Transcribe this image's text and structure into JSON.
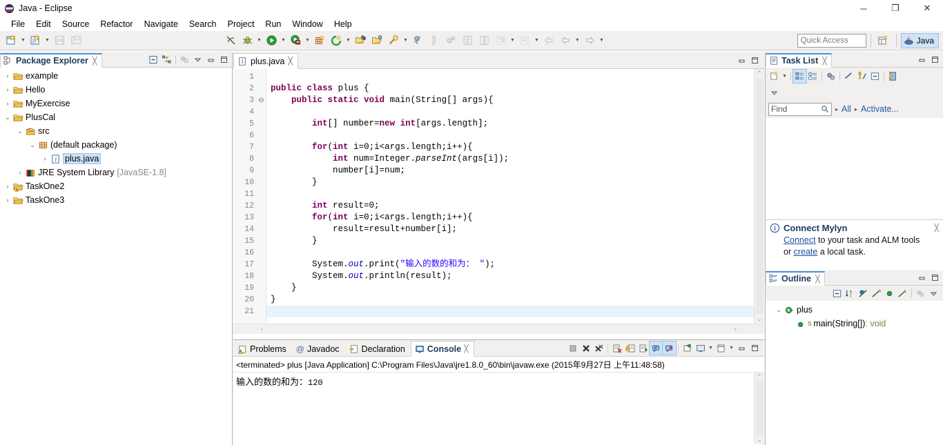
{
  "window": {
    "title": "Java - Eclipse",
    "app_icon": "eclipse-icon",
    "minimize": "─",
    "maximize": "❐",
    "close": "✕"
  },
  "menu": {
    "items": [
      {
        "label": "File"
      },
      {
        "label": "Edit"
      },
      {
        "label": "Source"
      },
      {
        "label": "Refactor"
      },
      {
        "label": "Navigate"
      },
      {
        "label": "Search"
      },
      {
        "label": "Project"
      },
      {
        "label": "Run"
      },
      {
        "label": "Window"
      },
      {
        "label": "Help"
      }
    ]
  },
  "toolbar": {
    "icons": [
      {
        "name": "new-wizard-icon"
      },
      {
        "name": "new-java-class-icon"
      },
      {
        "name": "save-icon"
      },
      {
        "name": "save-all-icon"
      },
      {
        "name": "toggle-mark-occurrences-icon"
      },
      {
        "name": "debug-icon"
      },
      {
        "name": "run-icon"
      },
      {
        "name": "run-external-tools-icon"
      },
      {
        "name": "new-java-package-icon"
      },
      {
        "name": "coverage-icon"
      },
      {
        "name": "open-type-icon"
      },
      {
        "name": "open-task-icon"
      },
      {
        "name": "search-icon"
      },
      {
        "name": "skip-all-breakpoints-icon"
      },
      {
        "name": "next-annotation-icon"
      },
      {
        "name": "previous-annotation-icon"
      },
      {
        "name": "last-edit-location-icon"
      },
      {
        "name": "back-icon"
      },
      {
        "name": "forward-icon"
      }
    ],
    "quick_access_placeholder": "Quick Access",
    "open-perspective-icon": "open-perspective-icon",
    "perspective_label": "Java",
    "perspective_icon": "java-perspective-icon"
  },
  "package_explorer": {
    "title": "Package Explorer",
    "tab_close": "╳",
    "tools": [
      {
        "name": "collapse-all-icon"
      },
      {
        "name": "link-with-editor-icon"
      },
      {
        "name": "focus-on-active-task-icon"
      },
      {
        "name": "view-menu-icon"
      },
      {
        "name": "minimize-icon"
      },
      {
        "name": "maximize-icon"
      }
    ],
    "tree": [
      {
        "label": "example",
        "icon": "project-folder-icon",
        "indent": 0,
        "twisty": "›",
        "selected": false
      },
      {
        "label": "Hello",
        "icon": "project-folder-icon",
        "indent": 0,
        "twisty": "›",
        "selected": false
      },
      {
        "label": "MyExercise",
        "icon": "project-folder-icon",
        "indent": 0,
        "twisty": "›",
        "selected": false
      },
      {
        "label": "PlusCal",
        "icon": "project-folder-icon",
        "indent": 0,
        "twisty": "⌄",
        "selected": false
      },
      {
        "label": "src",
        "icon": "source-folder-icon",
        "indent": 1,
        "twisty": "⌄",
        "selected": false
      },
      {
        "label": "(default package)",
        "icon": "package-icon",
        "indent": 2,
        "twisty": "⌄",
        "selected": false
      },
      {
        "label": "plus.java",
        "icon": "java-file-icon",
        "indent": 3,
        "twisty": "›",
        "selected": true
      },
      {
        "label": "JRE System Library",
        "sublabel": "[JavaSE-1.8]",
        "icon": "jre-library-icon",
        "indent": 1,
        "twisty": "›",
        "selected": false
      },
      {
        "label": "TaskOne2",
        "icon": "project-folder-warning-icon",
        "indent": 0,
        "twisty": "›",
        "selected": false
      },
      {
        "label": "TaskOne3",
        "icon": "project-folder-icon",
        "indent": 0,
        "twisty": "›",
        "selected": false
      }
    ]
  },
  "editor": {
    "tab_label": "plus.java",
    "tab_icon": "java-file-icon",
    "tab_close": "╳",
    "tools": [
      {
        "name": "minimize-icon"
      },
      {
        "name": "maximize-icon"
      }
    ],
    "current_line": 21,
    "lines": [
      {
        "n": 1,
        "fold": "",
        "tokens": []
      },
      {
        "n": 2,
        "fold": "",
        "tokens": [
          {
            "t": "public ",
            "c": "kw"
          },
          {
            "t": "class ",
            "c": "kw"
          },
          {
            "t": "plus {",
            "c": "pl"
          }
        ]
      },
      {
        "n": 3,
        "fold": "⊖",
        "tokens": [
          {
            "t": "    ",
            "c": "pl"
          },
          {
            "t": "public ",
            "c": "kw"
          },
          {
            "t": "static ",
            "c": "kw"
          },
          {
            "t": "void ",
            "c": "kw"
          },
          {
            "t": "main(String[] args){",
            "c": "pl"
          }
        ]
      },
      {
        "n": 4,
        "fold": "",
        "tokens": []
      },
      {
        "n": 5,
        "fold": "",
        "tokens": [
          {
            "t": "        ",
            "c": "pl"
          },
          {
            "t": "int",
            "c": "kw"
          },
          {
            "t": "[] number=",
            "c": "pl"
          },
          {
            "t": "new ",
            "c": "kw"
          },
          {
            "t": "int",
            "c": "kw"
          },
          {
            "t": "[args.length];",
            "c": "pl"
          }
        ]
      },
      {
        "n": 6,
        "fold": "",
        "tokens": []
      },
      {
        "n": 7,
        "fold": "",
        "tokens": [
          {
            "t": "        ",
            "c": "pl"
          },
          {
            "t": "for",
            "c": "kw"
          },
          {
            "t": "(",
            "c": "pl"
          },
          {
            "t": "int ",
            "c": "kw"
          },
          {
            "t": "i=0;i<args.length;i++){",
            "c": "pl"
          }
        ]
      },
      {
        "n": 8,
        "fold": "",
        "tokens": [
          {
            "t": "            ",
            "c": "pl"
          },
          {
            "t": "int ",
            "c": "kw"
          },
          {
            "t": "num=Integer.",
            "c": "pl"
          },
          {
            "t": "parseInt",
            "c": "mth"
          },
          {
            "t": "(args[i]);",
            "c": "pl"
          }
        ]
      },
      {
        "n": 9,
        "fold": "",
        "tokens": [
          {
            "t": "            number[i]=num;",
            "c": "pl"
          }
        ]
      },
      {
        "n": 10,
        "fold": "",
        "tokens": [
          {
            "t": "        }",
            "c": "pl"
          }
        ]
      },
      {
        "n": 11,
        "fold": "",
        "tokens": []
      },
      {
        "n": 12,
        "fold": "",
        "tokens": [
          {
            "t": "        ",
            "c": "pl"
          },
          {
            "t": "int ",
            "c": "kw"
          },
          {
            "t": "result=0;",
            "c": "pl"
          }
        ]
      },
      {
        "n": 13,
        "fold": "",
        "tokens": [
          {
            "t": "        ",
            "c": "pl"
          },
          {
            "t": "for",
            "c": "kw"
          },
          {
            "t": "(",
            "c": "pl"
          },
          {
            "t": "int ",
            "c": "kw"
          },
          {
            "t": "i=0;i<args.length;i++){",
            "c": "pl"
          }
        ]
      },
      {
        "n": 14,
        "fold": "",
        "tokens": [
          {
            "t": "            result=result+number[i];",
            "c": "pl"
          }
        ]
      },
      {
        "n": 15,
        "fold": "",
        "tokens": [
          {
            "t": "        }",
            "c": "pl"
          }
        ]
      },
      {
        "n": 16,
        "fold": "",
        "tokens": []
      },
      {
        "n": 17,
        "fold": "",
        "tokens": [
          {
            "t": "        System.",
            "c": "pl"
          },
          {
            "t": "out",
            "c": "fld"
          },
          {
            "t": ".print(",
            "c": "pl"
          },
          {
            "t": "\"输入的数的和为： \"",
            "c": "str"
          },
          {
            "t": ");",
            "c": "pl"
          }
        ]
      },
      {
        "n": 18,
        "fold": "",
        "tokens": [
          {
            "t": "        System.",
            "c": "pl"
          },
          {
            "t": "out",
            "c": "fld"
          },
          {
            "t": ".println(result);",
            "c": "pl"
          }
        ]
      },
      {
        "n": 19,
        "fold": "",
        "tokens": [
          {
            "t": "    }",
            "c": "pl"
          }
        ]
      },
      {
        "n": 20,
        "fold": "",
        "tokens": [
          {
            "t": "}",
            "c": "pl"
          }
        ]
      },
      {
        "n": 21,
        "fold": "",
        "tokens": []
      }
    ]
  },
  "console_panel": {
    "tabs": [
      {
        "label": "Problems",
        "icon": "problems-icon",
        "active": false
      },
      {
        "label": "Javadoc",
        "icon": "javadoc-icon",
        "active": false
      },
      {
        "label": "Declaration",
        "icon": "declaration-icon",
        "active": false
      },
      {
        "label": "Console",
        "icon": "console-icon",
        "active": true
      }
    ],
    "tab_close": "╳",
    "tools": [
      {
        "name": "terminate-icon"
      },
      {
        "name": "remove-launch-icon"
      },
      {
        "name": "remove-all-terminated-icon"
      },
      {
        "name": "clear-console-icon"
      },
      {
        "name": "scroll-lock-icon"
      },
      {
        "name": "word-wrap-icon"
      },
      {
        "name": "show-console-on-output-icon"
      },
      {
        "name": "show-console-on-error-icon"
      },
      {
        "name": "pin-console-icon"
      },
      {
        "name": "display-selected-console-icon"
      },
      {
        "name": "open-console-icon"
      },
      {
        "name": "minimize-icon"
      },
      {
        "name": "maximize-icon"
      }
    ],
    "launch_header": "<terminated> plus [Java Application] C:\\Program Files\\Java\\jre1.8.0_60\\bin\\javaw.exe (2015年9月27日 上午11:48:58)",
    "output_text": "输入的数的和为：",
    "output_value": "120"
  },
  "task_list": {
    "title": "Task List",
    "tab_close": "╳",
    "tools": [
      {
        "name": "new-task-icon"
      },
      {
        "name": "categorized-presentation-icon"
      },
      {
        "name": "scheduled-presentation-icon"
      },
      {
        "name": "focus-on-workweek-icon"
      },
      {
        "name": "synchronize-changed-icon"
      },
      {
        "name": "show-ui-legend-icon"
      },
      {
        "name": "collapse-all-icon"
      },
      {
        "name": "restore-task-list-icon"
      },
      {
        "name": "view-menu-icon"
      },
      {
        "name": "minimize-icon"
      },
      {
        "name": "maximize-icon"
      }
    ],
    "find_placeholder": "Find",
    "search_icon": "magnifier-icon",
    "filter_all": "All",
    "filter_activate": "Activate...",
    "arrow_glyph": "▸"
  },
  "mylyn": {
    "title": "Connect Mylyn",
    "info_icon": "info-icon",
    "close": "╳",
    "line1_link": "Connect",
    "line1_rest": " to your task and ALM tools",
    "line2_pre": "or ",
    "line2_link": "create",
    "line2_rest": " a local task."
  },
  "outline": {
    "title": "Outline",
    "tab_close": "╳",
    "tools": [
      {
        "name": "collapse-all-icon"
      },
      {
        "name": "sort-icon"
      },
      {
        "name": "hide-fields-icon"
      },
      {
        "name": "hide-static-icon"
      },
      {
        "name": "hide-non-public-icon"
      },
      {
        "name": "hide-local-types-icon"
      },
      {
        "name": "focus-on-active-task-icon"
      },
      {
        "name": "view-menu-icon"
      },
      {
        "name": "minimize-icon"
      },
      {
        "name": "maximize-icon"
      }
    ],
    "tree": [
      {
        "label": "plus",
        "icon": "class-icon",
        "indent": 0,
        "twisty": "⌄",
        "badge": ""
      },
      {
        "label": "main(String[])",
        "return": " : void",
        "icon": "method-public-icon",
        "indent": 1,
        "twisty": "",
        "badge": "S"
      }
    ]
  },
  "colors": {
    "keyword": "#7f0055",
    "string": "#2a00ff",
    "field": "#0000c0",
    "accent": "#4a90d9",
    "selection": "#cde1f7",
    "tab_active_top": "#4a90d9"
  }
}
